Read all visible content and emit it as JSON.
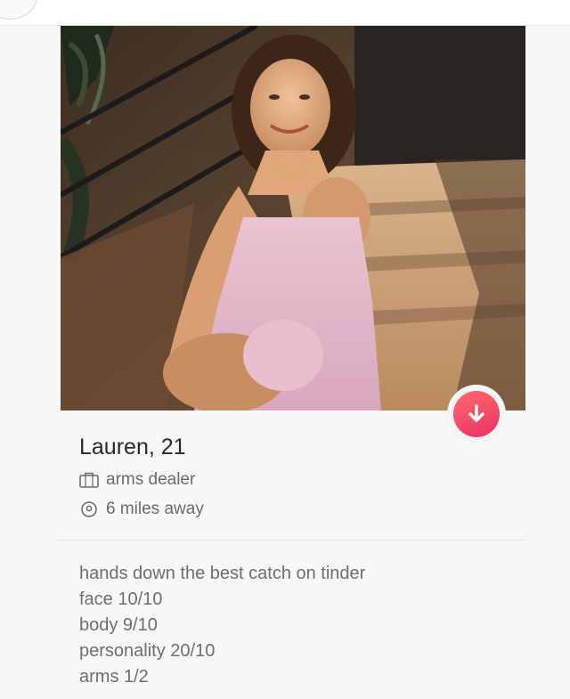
{
  "profile": {
    "name_age": "Lauren, 21",
    "job": "arms dealer",
    "distance": "6 miles away",
    "bio_lines": [
      "hands down the best catch on tinder",
      "face 10/10",
      "body 9/10",
      "personality 20/10",
      "arms 1/2"
    ]
  },
  "icons": {
    "job": "briefcase-icon",
    "distance": "location-pin-icon",
    "action": "arrow-down-icon"
  },
  "colors": {
    "action_gradient_start": "#ff6a6a",
    "action_gradient_end": "#ea3168",
    "text_primary": "#2a2a2a",
    "text_secondary": "#6a6a6a"
  }
}
